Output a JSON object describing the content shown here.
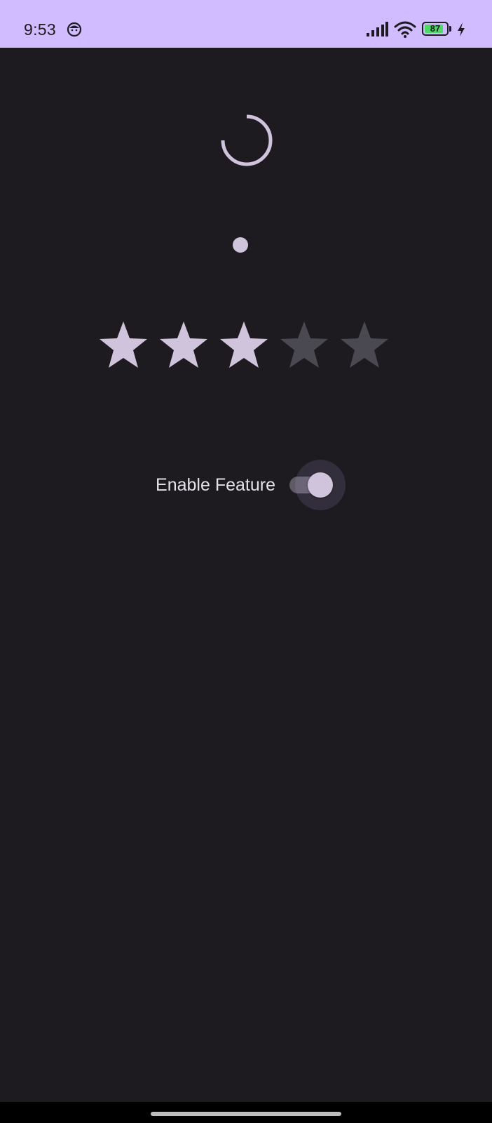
{
  "status_bar": {
    "time": "9:53",
    "battery_level": "87",
    "notification_icon": "face-notification-icon",
    "signal_icon": "cellular-signal-icon",
    "wifi_icon": "wifi-icon",
    "charging_icon": "charging-bolt-icon",
    "background_color": "#d0bcff",
    "battery_fill_color": "#4cd964"
  },
  "loading_indicator": {
    "icon": "circular-progress-icon",
    "color": "#cfc4dc"
  },
  "slider": {
    "value_fraction": 0.0,
    "color": "#cfc4dc"
  },
  "rating": {
    "value": 3,
    "max": 5,
    "filled_color": "#cfc4dc",
    "empty_color": "#4a4850"
  },
  "feature_toggle": {
    "label": "Enable Feature",
    "checked": true,
    "thumb_color": "#cfc4dc",
    "track_color": "#5f5966"
  },
  "theme": {
    "background": "#1d1b20",
    "text_color": "#e6e0e9"
  }
}
